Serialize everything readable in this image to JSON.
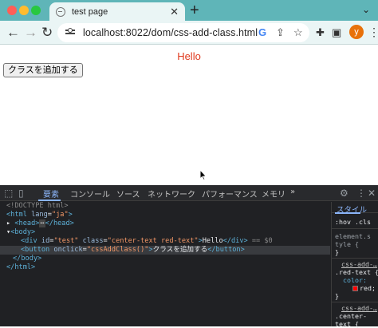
{
  "tab": {
    "title": "test page",
    "close": "✕"
  },
  "newtab": "+",
  "tabstrip_chevron": "⌄",
  "nav": {
    "back": "←",
    "forward": "→",
    "reload": "↻"
  },
  "omnibox": {
    "url": "localhost:8022/dom/css-add-class.html"
  },
  "profile": {
    "initial": "y"
  },
  "page": {
    "hello": "Hello",
    "button_label": "クラスを追加する"
  },
  "devtools": {
    "tabs": [
      "要素",
      "コンソール",
      "ソース",
      "ネットワーク",
      "パフォーマンス",
      "メモリ"
    ],
    "more": "»",
    "dom": {
      "doctype": "<!DOCTYPE html>",
      "html_open": "<html",
      "lang_attr": "lang",
      "lang_val": "\"ja\"",
      "head": "<head>",
      "head_dots": "⋯",
      "head_close": "</head>",
      "body": "<body>",
      "div_open": "<div",
      "id_attr": "id",
      "id_val": "\"test\"",
      "class_attr": "class",
      "class_val": "\"center-text red-text\"",
      "div_text": "Hello",
      "div_close": "</div>",
      "selected_marker": "== $0",
      "button_open": "<button",
      "onclick_attr": "onclick",
      "onclick_val": "\"cssAddClass()\"",
      "button_text": "クラスを追加する",
      "button_close": "</button>",
      "body_close": "</body>",
      "html_close": "</html>",
      "gt": ">",
      "eq": "="
    },
    "styles": {
      "tab": "スタイル",
      "filter": ":hov .cls",
      "element_style": "element.s",
      "element_style2": "tyle {",
      "brace_close": "}",
      "rule1_src": "css-add-…",
      "rule1_sel": ".red-text {",
      "rule1_prop": "color:",
      "rule1_val": "red;",
      "rule2_src": "css-add-…",
      "rule2_sel": ".center-",
      "rule2_sel2": "text {"
    }
  },
  "colors": {
    "hello_text": "#e03a1e",
    "titlebar": "#5fb5b8",
    "devtools_accent": "#8ab4f8",
    "avatar": "#e8710a"
  }
}
